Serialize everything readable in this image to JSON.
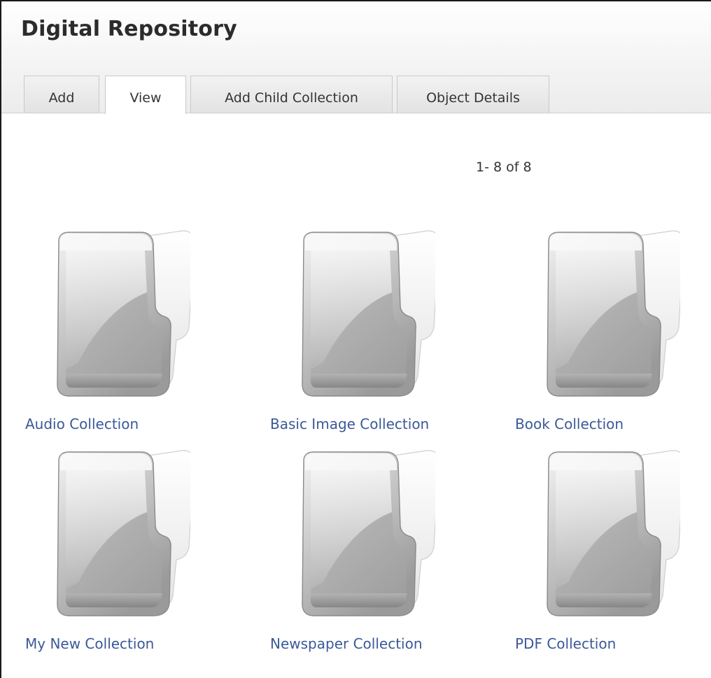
{
  "header": {
    "title": "Digital Repository"
  },
  "tabs": [
    {
      "label": "Add"
    },
    {
      "label": "View",
      "active": true
    },
    {
      "label": "Add Child Collection"
    },
    {
      "label": "Object Details"
    }
  ],
  "pager": {
    "text": "1- 8 of 8"
  },
  "collections": [
    {
      "label": "Audio Collection",
      "icon": "folder-icon"
    },
    {
      "label": "Basic Image Collection",
      "icon": "folder-icon"
    },
    {
      "label": "Book Collection",
      "icon": "folder-icon"
    },
    {
      "label": "My New Collection",
      "icon": "folder-icon"
    },
    {
      "label": "Newspaper Collection",
      "icon": "folder-icon"
    },
    {
      "label": "PDF Collection",
      "icon": "folder-icon"
    }
  ],
  "colors": {
    "link": "#3b5998",
    "title": "#2b2b2b"
  }
}
